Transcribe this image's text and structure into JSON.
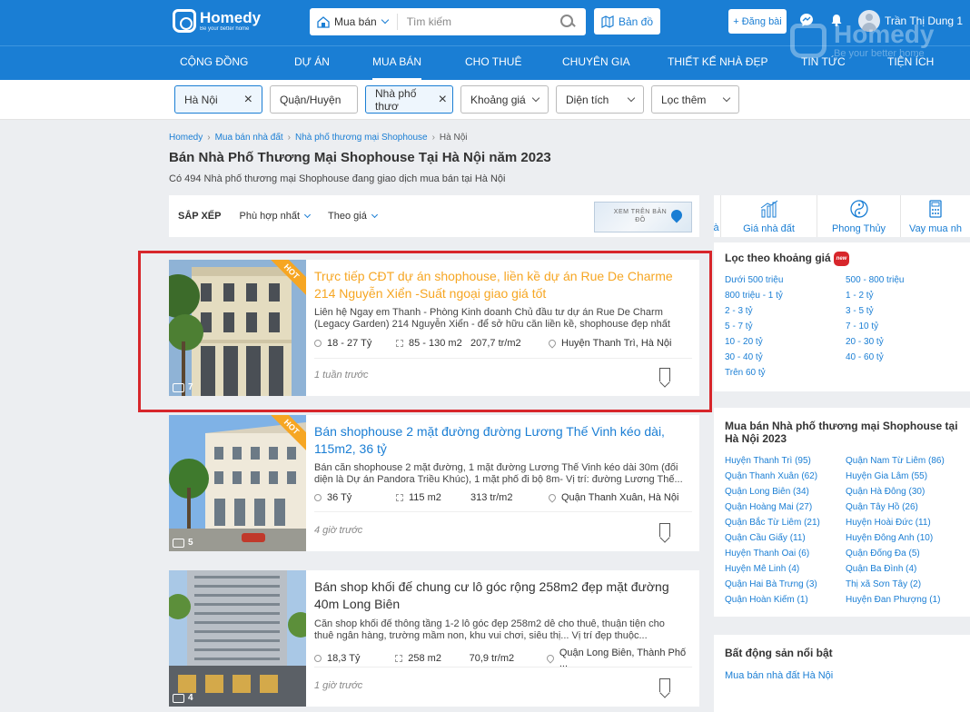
{
  "header": {
    "logo_name": "Homedy",
    "logo_tag": "Be your better home",
    "search_type": "Mua bán",
    "search_placeholder": "Tìm kiếm",
    "map_label": "Bản đồ",
    "post_label": "+ Đăng bài",
    "user_name": "Trần Thị Dung 1",
    "watermark_name": "Homedy",
    "watermark_tag": "Be your better home"
  },
  "nav": [
    {
      "label": "Cộng đồng"
    },
    {
      "label": "Dự án"
    },
    {
      "label": "Mua bán"
    },
    {
      "label": "Cho thuê"
    },
    {
      "label": "Chuyên gia"
    },
    {
      "label": "Thiết kế nhà đẹp"
    },
    {
      "label": "Tin tức"
    },
    {
      "label": "Tiện ích"
    }
  ],
  "filters": {
    "city": "Hà Nội",
    "district": "Quận/Huyện",
    "type": "Nhà phố thươ",
    "price": "Khoảng giá",
    "area": "Diện tích",
    "more": "Lọc thêm"
  },
  "breadcrumb": [
    "Homedy",
    "Mua bán nhà đất",
    "Nhà phố thương mại Shophouse",
    "Hà Nội"
  ],
  "title": "Bán Nhà Phố Thương Mại Shophouse Tại Hà Nội năm 2023",
  "subtitle": "Có 494 Nhà phố thương mại Shophouse đang giao dịch mua bán tại Hà Nội",
  "sort": {
    "label": "SẮP XẾP",
    "relevance": "Phù hợp nhất",
    "price": "Theo giá",
    "map_thumb": "XEM TRÊN BẢN ĐỒ"
  },
  "listings": [
    {
      "hot": "HOT",
      "photos": "7",
      "title": "Trực tiếp CĐT dự án shophouse, liền kề dự án Rue De Charme 214 Nguyễn Xiển -Suất ngoại giao giá tốt",
      "desc": "Liên hệ Ngay em Thanh - Phòng Kinh doanh Chủ đầu tư dự án Rue De Charm (Legacy Garden) 214 Nguyễn Xiển - để sở hữu căn liền kề, shophouse đẹp nhất với giá...",
      "price": "18 - 27 Tỷ",
      "area": "85 - 130 m2",
      "unit_price": "207,7 tr/m2",
      "location": "Huyện Thanh Trì, Hà Nội",
      "time": "1 tuần trước"
    },
    {
      "hot": "HOT",
      "photos": "5",
      "title": "Bán shophouse 2 mặt đường đường Lương Thế Vinh kéo dài, 115m2, 36 tỷ",
      "desc": "Bán căn shophouse 2 mặt đường, 1 mặt đường Lương Thế Vinh kéo dài 30m (đối diện là Dự án Pandora Triều Khúc), 1 mặt phố đi bộ 8m- Vị trí: đường Lương Thế...",
      "price": "36 Tỷ",
      "area": "115 m2",
      "unit_price": "313 tr/m2",
      "location": "Quận Thanh Xuân, Hà Nội",
      "time": "4 giờ trước"
    },
    {
      "photos": "4",
      "title": "Bán shop khối đế chung cư lô góc rộng 258m2 đẹp mặt đường 40m Long Biên",
      "desc": "Căn shop khối đế thông tầng 1-2 lô góc đẹp 258m2 dễ cho thuê, thuận tiện cho thuê ngân hàng, trường mầm non, khu vui chơi, siêu thị... Vị trí đẹp thuộc...",
      "price": "18,3 Tỷ",
      "area": "258 m2",
      "unit_price": "70,9 tr/m2",
      "location": "Quận Long Biên, Thành Phố ...",
      "time": "1 giờ trước"
    }
  ],
  "utilities": [
    {
      "label": "à"
    },
    {
      "label": "Giá nhà đất"
    },
    {
      "label": "Phong Thủy"
    },
    {
      "label": "Vay mua nh"
    }
  ],
  "price_filter": {
    "title": "Lọc theo khoảng giá",
    "badge": "new",
    "left": [
      "Dưới 500 triệu",
      "800 triệu - 1 tỷ",
      "2 - 3 tỷ",
      "5 - 7 tỷ",
      "10 - 20 tỷ",
      "30 - 40 tỷ",
      "Trên 60 tỷ"
    ],
    "right": [
      "500 - 800 triệu",
      "1 - 2 tỷ",
      "3 - 5 tỷ",
      "7 - 10 tỷ",
      "20 - 30 tỷ",
      "40 - 60 tỷ"
    ]
  },
  "district_panel": {
    "title": "Mua bán Nhà phố thương mại Shophouse tại Hà Nội 2023",
    "left": [
      "Huyện Thanh Trì (95)",
      "Quận Thanh Xuân (62)",
      "Quận Long Biên (34)",
      "Quận Hoàng Mai (27)",
      "Quận Bắc Từ Liêm (21)",
      "Quận Cầu Giấy (11)",
      "Huyện Thanh Oai (6)",
      "Huyện Mê Linh (4)",
      "Quận Hai Bà Trưng (3)",
      "Quận Hoàn Kiếm (1)"
    ],
    "right": [
      "Quận Nam Từ Liêm (86)",
      "Huyện Gia Lâm (55)",
      "Quận Hà Đông (30)",
      "Quận Tây Hồ (26)",
      "Huyện Hoài Đức (11)",
      "Huyện Đông Anh (10)",
      "Quận Đống Đa (5)",
      "Quận Ba Đình (4)",
      "Thị xã Sơn Tây (2)",
      "Huyện Đan Phượng (1)"
    ]
  },
  "featured": {
    "title": "Bất động sản nổi bật",
    "link": "Mua bán nhà đất Hà Nội"
  }
}
